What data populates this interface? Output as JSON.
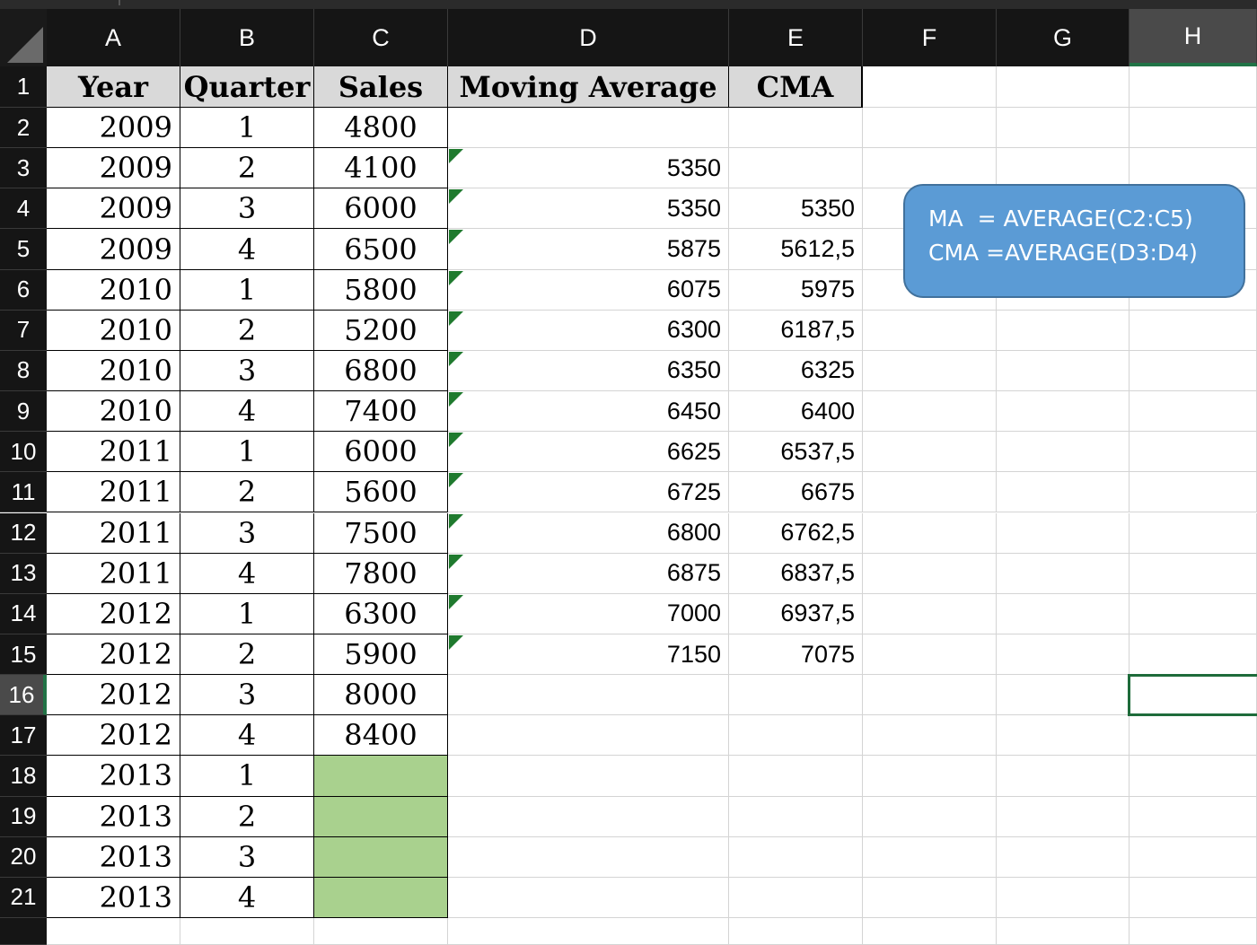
{
  "columns": [
    "A",
    "B",
    "C",
    "D",
    "E",
    "F",
    "G",
    "H"
  ],
  "selected_column": "H",
  "selected_row": "16",
  "row_numbers": [
    "1",
    "2",
    "3",
    "4",
    "5",
    "6",
    "7",
    "8",
    "9",
    "10",
    "11",
    "12",
    "13",
    "14",
    "15",
    "16",
    "17",
    "18",
    "19",
    "20",
    "21"
  ],
  "headers": {
    "year": "Year",
    "quarter": "Quarter",
    "sales": "Sales",
    "ma": "Moving Average",
    "cma": "CMA"
  },
  "rows": [
    {
      "year": "2009",
      "quarter": "1",
      "sales": "4800",
      "ma": "",
      "cma": ""
    },
    {
      "year": "2009",
      "quarter": "2",
      "sales": "4100",
      "ma": "5350",
      "cma": ""
    },
    {
      "year": "2009",
      "quarter": "3",
      "sales": "6000",
      "ma": "5350",
      "cma": "5350"
    },
    {
      "year": "2009",
      "quarter": "4",
      "sales": "6500",
      "ma": "5875",
      "cma": "5612,5"
    },
    {
      "year": "2010",
      "quarter": "1",
      "sales": "5800",
      "ma": "6075",
      "cma": "5975"
    },
    {
      "year": "2010",
      "quarter": "2",
      "sales": "5200",
      "ma": "6300",
      "cma": "6187,5"
    },
    {
      "year": "2010",
      "quarter": "3",
      "sales": "6800",
      "ma": "6350",
      "cma": "6325"
    },
    {
      "year": "2010",
      "quarter": "4",
      "sales": "7400",
      "ma": "6450",
      "cma": "6400"
    },
    {
      "year": "2011",
      "quarter": "1",
      "sales": "6000",
      "ma": "6625",
      "cma": "6537,5"
    },
    {
      "year": "2011",
      "quarter": "2",
      "sales": "5600",
      "ma": "6725",
      "cma": "6675"
    },
    {
      "year": "2011",
      "quarter": "3",
      "sales": "7500",
      "ma": "6800",
      "cma": "6762,5"
    },
    {
      "year": "2011",
      "quarter": "4",
      "sales": "7800",
      "ma": "6875",
      "cma": "6837,5"
    },
    {
      "year": "2012",
      "quarter": "1",
      "sales": "6300",
      "ma": "7000",
      "cma": "6937,5"
    },
    {
      "year": "2012",
      "quarter": "2",
      "sales": "5900",
      "ma": "7150",
      "cma": "7075"
    },
    {
      "year": "2012",
      "quarter": "3",
      "sales": "8000",
      "ma": "",
      "cma": ""
    },
    {
      "year": "2012",
      "quarter": "4",
      "sales": "8400",
      "ma": "",
      "cma": ""
    },
    {
      "year": "2013",
      "quarter": "1",
      "sales": "",
      "ma": "",
      "cma": ""
    },
    {
      "year": "2013",
      "quarter": "2",
      "sales": "",
      "ma": "",
      "cma": ""
    },
    {
      "year": "2013",
      "quarter": "3",
      "sales": "",
      "ma": "",
      "cma": ""
    },
    {
      "year": "2013",
      "quarter": "4",
      "sales": "",
      "ma": "",
      "cma": ""
    }
  ],
  "callout": {
    "line1": "MA  = AVERAGE(C2:C5)",
    "line2": "CMA =AVERAGE(D3:D4)"
  },
  "colors": {
    "header_bg": "#151515",
    "forecast_fill": "#a9d18e",
    "callout_fill": "#5b9bd5",
    "selection": "#1e6b3a",
    "table_header_fill": "#d9d9d9"
  }
}
